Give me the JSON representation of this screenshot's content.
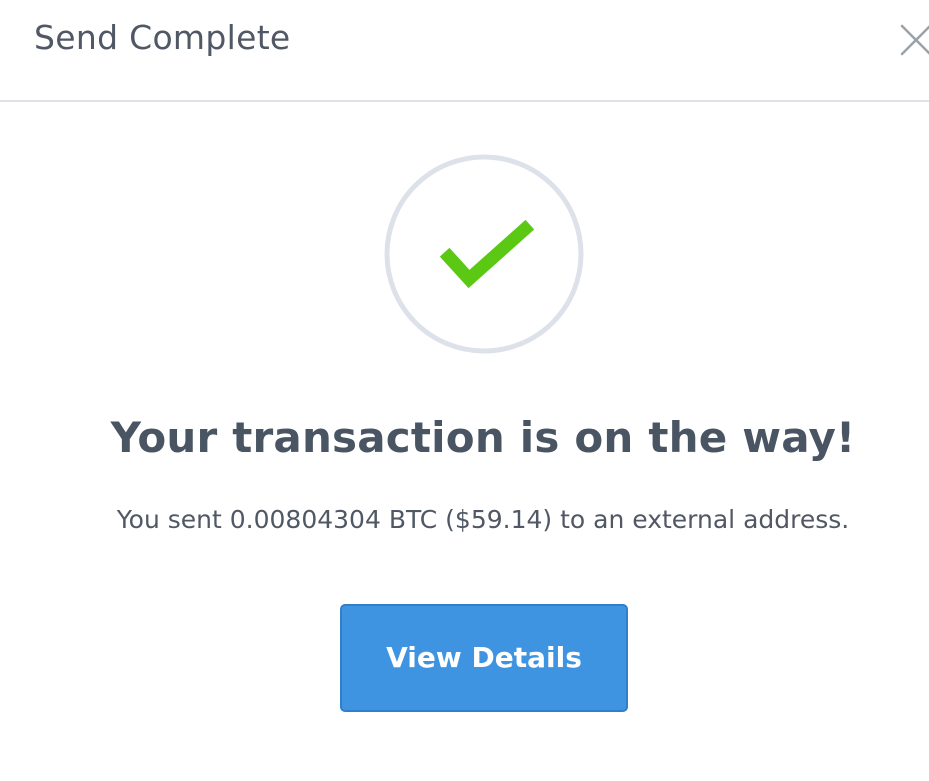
{
  "header": {
    "title": "Send Complete",
    "close_icon": "close-icon"
  },
  "status": {
    "icon": "checkmark-icon",
    "ring_color": "#dde2ea",
    "check_color": "#5bc813"
  },
  "main": {
    "headline": "Your transaction is on the way!",
    "summary": "You sent 0.00804304 BTC ($59.14) to an external address."
  },
  "actions": {
    "view_details_label": "View Details",
    "button_color": "#3f94e2"
  }
}
